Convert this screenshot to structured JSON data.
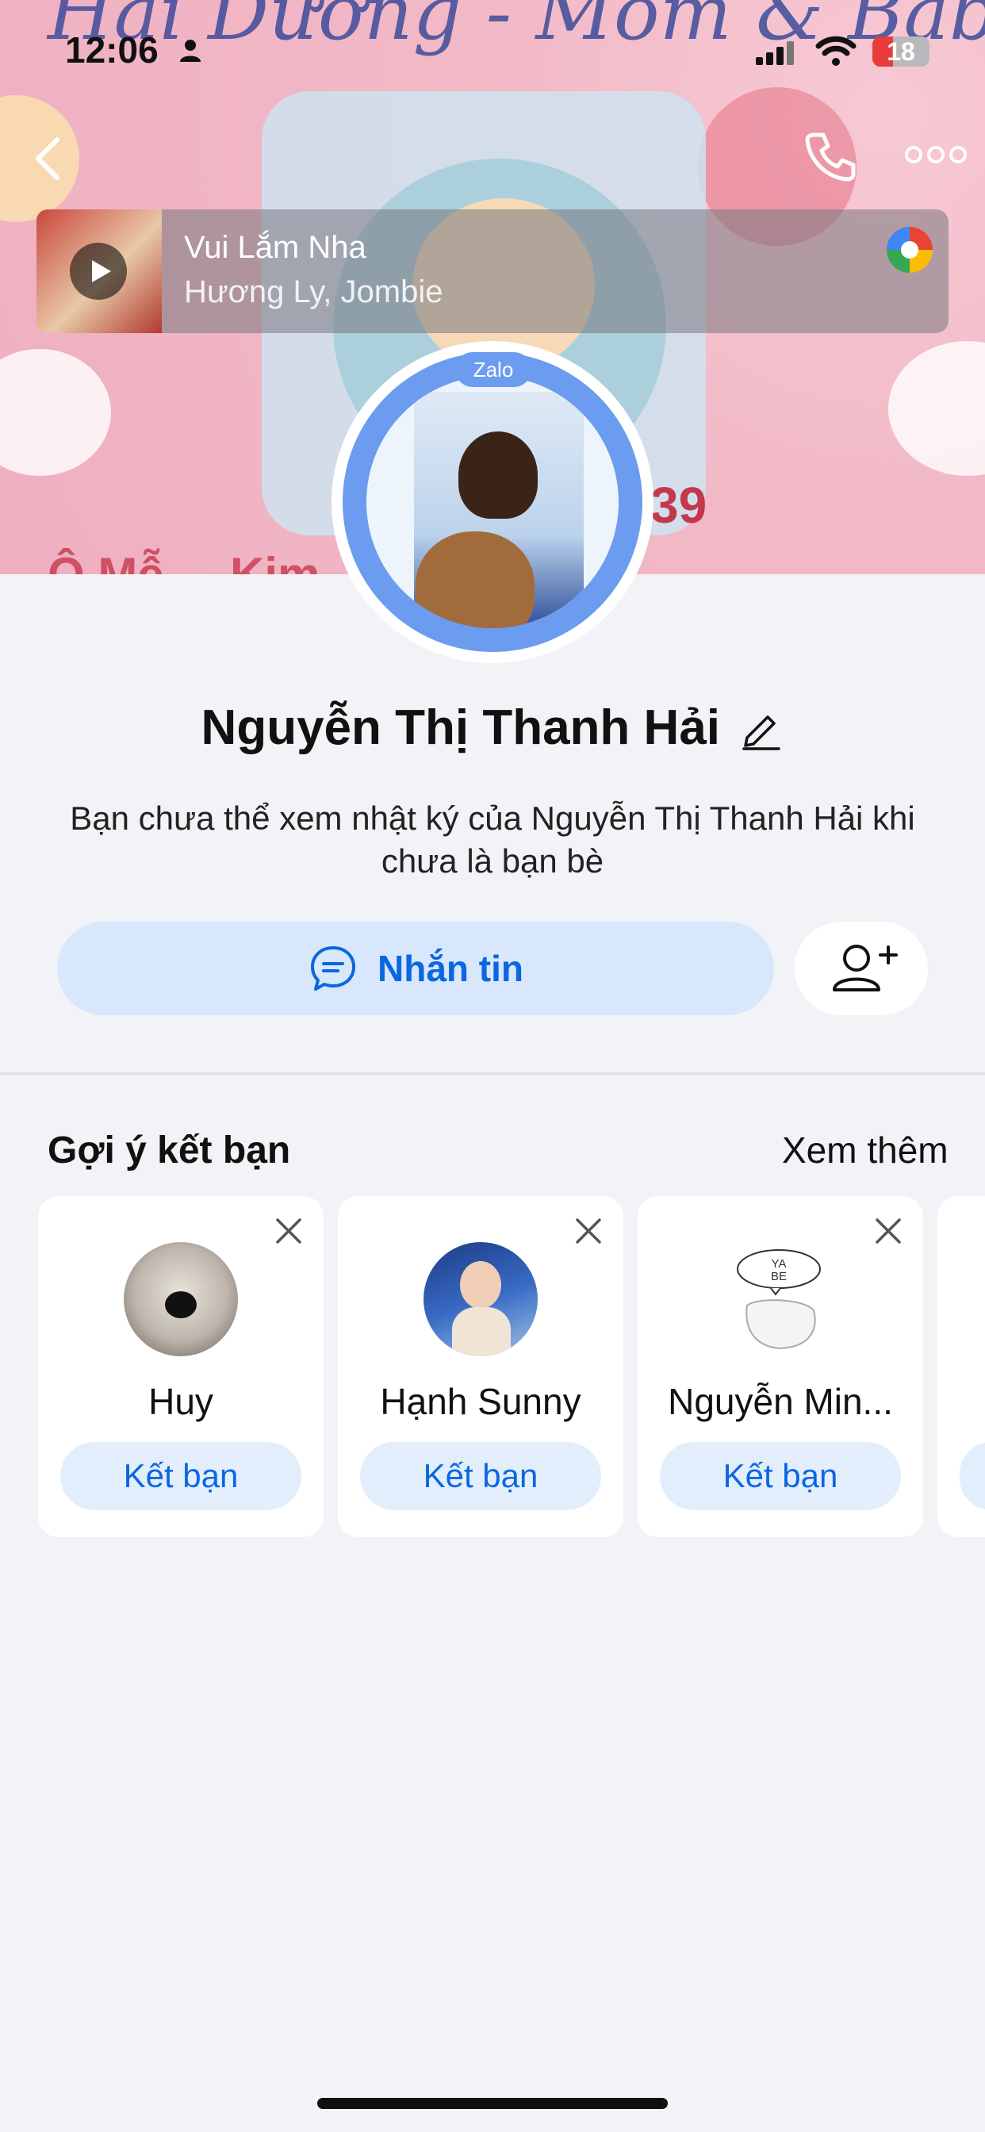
{
  "status_bar": {
    "time": "12:06",
    "battery": "18"
  },
  "cover": {
    "banner_text": "Hải Dương - Mom & Baby care",
    "phone_fragment": "39",
    "address_fragment": "Ô Mễ ... Kim ... Hải Dương"
  },
  "music": {
    "title": "Vui Lắm Nha",
    "artist": "Hương Ly, Jombie"
  },
  "avatar": {
    "badge": "Zalo"
  },
  "profile": {
    "name": "Nguyễn Thị Thanh Hải",
    "note": "Bạn chưa thể xem nhật ký của Nguyễn Thị Thanh Hải khi chưa là bạn bè",
    "message_button": "Nhắn tin"
  },
  "suggestions": {
    "title": "Gợi ý kết bạn",
    "see_more": "Xem thêm",
    "cards": [
      {
        "name": "Huy",
        "button": "Kết bạn"
      },
      {
        "name": "Hạnh Sunny",
        "button": "Kết bạn"
      },
      {
        "name": "Nguyễn Min...",
        "button": "Kết bạn"
      }
    ]
  },
  "colors": {
    "accent": "#0b67e0",
    "button_bg": "#d8e7fb",
    "page_bg": "#f2f3f6"
  }
}
